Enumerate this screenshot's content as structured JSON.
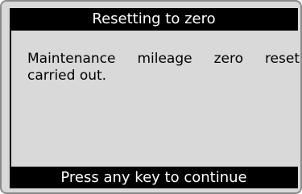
{
  "header": {
    "title": "Resetting to zero"
  },
  "main": {
    "message": "Maintenance mileage zero reset carried out."
  },
  "footer": {
    "prompt": "Press any key to continue"
  }
}
